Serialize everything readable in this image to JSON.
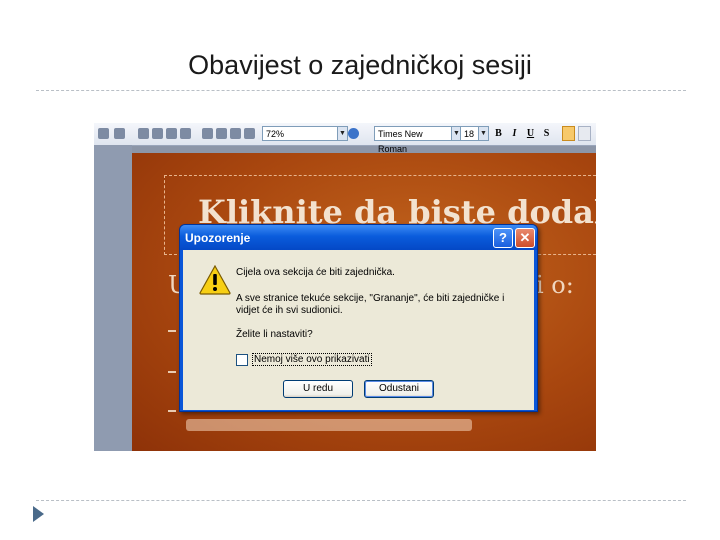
{
  "slide": {
    "title": "Obavijest o zajedničkoj sesiji"
  },
  "toolbar": {
    "zoom": "72%",
    "font_name": "Times New Roman",
    "font_size": "18",
    "bold": "B",
    "italic": "I",
    "underline": "U",
    "shadow": "S"
  },
  "ppt": {
    "title_text": "Kliknite da biste dodali n",
    "subtitle_left": "U",
    "subtitle_right": "i o:"
  },
  "dialog": {
    "title": "Upozorenje",
    "help_label": "?",
    "close_label": "✕",
    "line1": "Cijela ova sekcija će biti zajednička.",
    "line2": "A sve stranice tekuće sekcije, \"Grananje\", će biti zajedničke i",
    "line3": "vidjet će ih svi sudionici.",
    "question": "Želite li nastaviti?",
    "checkbox_label": "Nemoj više ovo prikazivati",
    "ok_label": "U redu",
    "cancel_label": "Odustani"
  },
  "colors": {
    "accent": "#0a56d8",
    "slide_bg": "#a9470f",
    "dialog_client": "#ece9d8"
  }
}
